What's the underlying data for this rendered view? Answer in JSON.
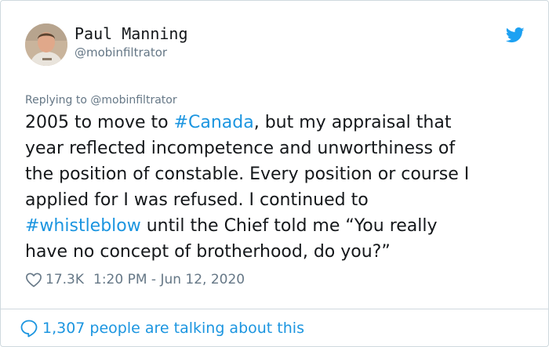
{
  "author": {
    "display_name": "Paul Manning",
    "handle": "@mobinfiltrator"
  },
  "reply": {
    "prefix": "Replying to",
    "target": "@mobinfiltrator"
  },
  "tweet": {
    "lines": [
      [
        {
          "text": "2005 to move to "
        },
        {
          "text": "#Canada",
          "hashtag": true
        },
        {
          "text": ", but my appraisal that"
        }
      ],
      [
        {
          "text": "year reflected incompetence and unworthiness of"
        }
      ],
      [
        {
          "text": "the position of constable. Every position or course I"
        }
      ],
      [
        {
          "text": "applied for I was refused. I continued to"
        }
      ],
      [
        {
          "text": "#whistleblow",
          "hashtag": true
        },
        {
          "text": " until the Chief told me “You really"
        }
      ],
      [
        {
          "text": "have no concept of brotherhood, do you?”"
        }
      ]
    ],
    "likes": "17.3K",
    "timestamp": "1:20 PM - Jun 12, 2020"
  },
  "footer": {
    "talking": "1,307 people are talking about this"
  },
  "icons": {
    "brand": "twitter-bird-icon",
    "like": "heart-outline-icon",
    "reply": "speech-bubble-icon"
  },
  "colors": {
    "link": "#1b95e0",
    "secondary_text": "#657786",
    "primary_text": "#14171a",
    "border": "#cfd9de"
  }
}
